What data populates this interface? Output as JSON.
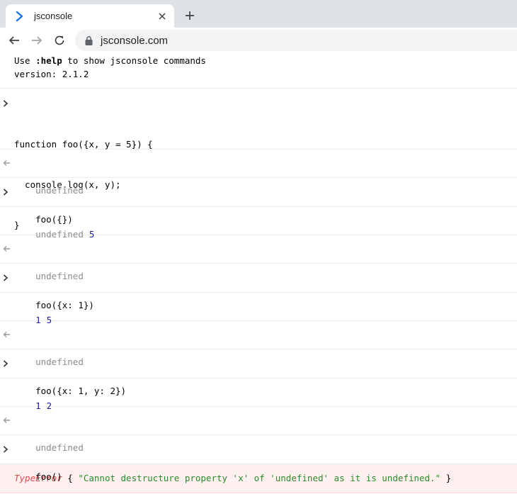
{
  "browser": {
    "tab_title": "jsconsole",
    "url": "jsconsole.com"
  },
  "banner": {
    "line1_pre": "Use ",
    "line1_cmd": ":help",
    "line1_post": " to show jsconsole commands",
    "line2": "version: 2.1.2"
  },
  "entries": [
    {
      "kind": "input",
      "lines": [
        "function foo({x, y = 5}) {",
        "  console.log(x, y);",
        "}"
      ]
    },
    {
      "kind": "result",
      "text": "undefined"
    },
    {
      "kind": "input",
      "lines": [
        "foo({})"
      ]
    },
    {
      "kind": "log",
      "parts": [
        "undefined",
        "5"
      ]
    },
    {
      "kind": "result",
      "text": "undefined"
    },
    {
      "kind": "input",
      "lines": [
        "foo({x: 1})"
      ]
    },
    {
      "kind": "log",
      "parts": [
        "1",
        "5"
      ]
    },
    {
      "kind": "result",
      "text": "undefined"
    },
    {
      "kind": "input",
      "lines": [
        "foo({x: 1, y: 2})"
      ]
    },
    {
      "kind": "log",
      "parts": [
        "1",
        "2"
      ]
    },
    {
      "kind": "result",
      "text": "undefined"
    },
    {
      "kind": "input",
      "lines": [
        "foo()"
      ]
    }
  ],
  "error": {
    "type": "TypeError",
    "open": " { ",
    "message": "\"Cannot destructure property 'x' of 'undefined' as it is undefined.\"",
    "close": " }"
  },
  "icons": {
    "favicon": "chevron-right-icon",
    "input_prompt": "chevron-right-icon",
    "result_prompt": "arrow-left-icon"
  },
  "colors": {
    "favicon": "#1a73e8",
    "number": "#1a1aa6",
    "undefined": "#8c8c8c",
    "error_type": "#e44b4b",
    "error_string": "#2a8a2a",
    "error_bg": "#fff0f0"
  }
}
